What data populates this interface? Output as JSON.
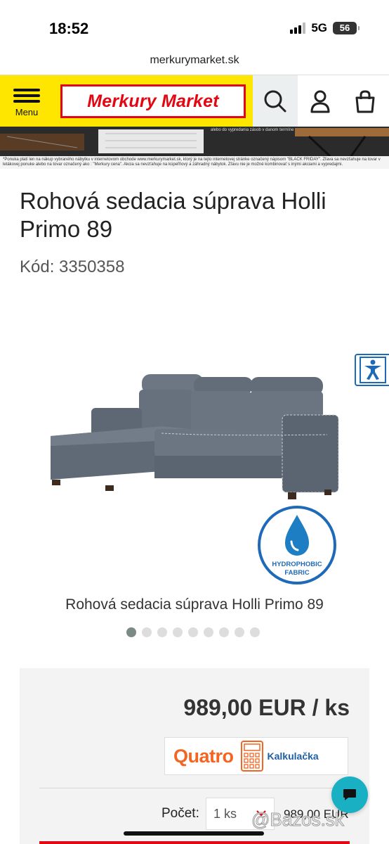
{
  "status_bar": {
    "time": "18:52",
    "network": "5G",
    "battery": "56"
  },
  "browser": {
    "url": "merkurymarket.sk"
  },
  "header": {
    "menu_label": "Menu",
    "logo_text": "Merkury Market",
    "brand_color": "#ffe600",
    "accent_color": "#e30613",
    "icons": [
      "search-icon",
      "user-icon",
      "cart-icon"
    ]
  },
  "promo": {
    "note": "*Ponuka platí len na nákup vybraného nábytku v internetovom obchode www.merkurymarket.sk, ktorý je na tejto internetovej stránke označený nápisom \"BLACK FRIDAY\". Zľava sa nevzťahuje na tovar v letákovej ponuke alebo na tovar označený ako : \"Merkury cena\". Akcia sa nevzťahuje na kúpeľňový a záhradný nábytok. Zľavu nie je možné kombinovať s inými akciami a vypredajmi.",
    "banner_text": "alebo do vypredania zásob v danom termíne"
  },
  "product": {
    "title": "Rohová sedacia súprava Holli Primo 89",
    "code": "Kód: 3350358",
    "image_caption": "Rohová sedacia súprava Holli Primo 89",
    "badge_line1": "HYDROPHOBIC",
    "badge_line2": "FABRIC",
    "carousel": {
      "total": 9,
      "active": 1
    }
  },
  "pricing": {
    "price": "989,00 EUR / ks",
    "quatro_brand": "Quatro",
    "quatro_label": "Kalkulačka",
    "quantity_label": "Počet:",
    "quantity_value": "1 ks",
    "quantity_total": "989,00 EUR"
  },
  "watermark": "@Bazos.sk"
}
